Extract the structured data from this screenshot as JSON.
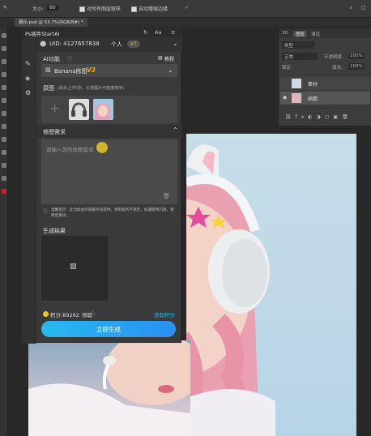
{
  "optbar": {
    "size_label": "大小:",
    "size_value": "60",
    "sample_all_layers": "对所有图层取样",
    "auto_enhance": "自动增强",
    "auto_edge": "自动增强边缘"
  },
  "document_tab": "網示.psd @ 53.7%(RGB/8#) *",
  "layers_panel": {
    "tabs": [
      "3D",
      "图层",
      "通道"
    ],
    "filter_label": "类型",
    "mode_label": "正常",
    "opacity_label": "不透明度:",
    "opacity_value": "100%",
    "lock_label": "锁定:",
    "fill_label": "填充:",
    "fill_value": "100%",
    "layers": [
      {
        "name": "素材",
        "visible": false
      },
      {
        "name": "画面",
        "visible": true
      }
    ]
  },
  "plugin": {
    "title": "Ps插件StartAI",
    "uid_label": "UID: 4127657838",
    "user_label": "个人",
    "vip_label": "V7",
    "ai_func_label": "AI功能",
    "tutorial_label": "教程",
    "model_name": "Banana修图",
    "model_version": "V3",
    "source_label": "原图",
    "source_hint": "(最多上传5张，长按图片可拖拽排序)",
    "req_label": "修图需求",
    "req_placeholder": "请输入您的修图需求",
    "hint_text": "温馨提示：此功能由外部服务商提供，偶有服务不稳定，如遇使用问题，请稍后重试。",
    "result_label": "生成结果",
    "points_label": "积分:89262",
    "collect_label": "领取",
    "get_points_label": "获取积分",
    "generate_label": "立即生成"
  },
  "colors": {
    "accent": "#27b9f0",
    "coin": "#f5c518",
    "panel_bg": "#3a3a3a"
  }
}
